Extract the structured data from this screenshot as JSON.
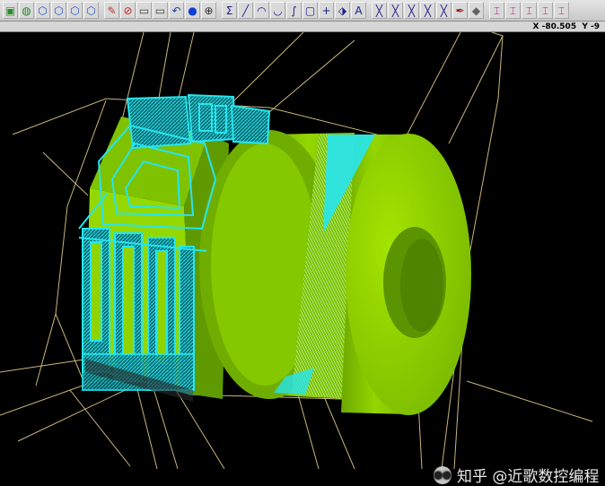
{
  "toolbar": {
    "buttons": [
      {
        "icon": "shaded-cube-icon",
        "glyph": "▣",
        "color": "#2a8a2a"
      },
      {
        "icon": "wire-cube-icon",
        "glyph": "◍",
        "color": "#2a8a2a"
      },
      {
        "icon": "view-cube-1-icon",
        "glyph": "⬡",
        "color": "#2456c8"
      },
      {
        "icon": "view-cube-2-icon",
        "glyph": "⬡",
        "color": "#2456c8"
      },
      {
        "icon": "view-cube-3-icon",
        "glyph": "⬡",
        "color": "#2456c8"
      },
      {
        "icon": "view-cube-4-icon",
        "glyph": "⬡",
        "color": "#2456c8"
      },
      {
        "icon": "pencil-icon",
        "glyph": "✎",
        "color": "#b03a3a"
      },
      {
        "icon": "no-entry-icon",
        "glyph": "⊘",
        "color": "#d02020"
      },
      {
        "icon": "monitor-icon",
        "glyph": "▭",
        "color": "#404040"
      },
      {
        "icon": "monitor-2-icon",
        "glyph": "▭",
        "color": "#404040"
      },
      {
        "icon": "undo-icon",
        "glyph": "↶",
        "color": "#2040a0"
      },
      {
        "icon": "sphere-icon",
        "glyph": "●",
        "color": "#1040d0"
      },
      {
        "icon": "zoom-icon",
        "glyph": "⊕",
        "color": "#303030"
      },
      {
        "icon": "sigma-icon",
        "glyph": "Σ",
        "color": "#1a1a8a"
      },
      {
        "icon": "line-icon",
        "glyph": "╱",
        "color": "#1a1a8a"
      },
      {
        "icon": "arc-icon",
        "glyph": "◠",
        "color": "#1a1a8a"
      },
      {
        "icon": "curve-icon",
        "glyph": "◡",
        "color": "#1a1a8a"
      },
      {
        "icon": "spline-icon",
        "glyph": "∫",
        "color": "#1a1a8a"
      },
      {
        "icon": "rectangle-icon",
        "glyph": "▢",
        "color": "#1a1a8a"
      },
      {
        "icon": "point-icon",
        "glyph": "+",
        "color": "#1a1a8a"
      },
      {
        "icon": "transform-icon",
        "glyph": "⬗",
        "color": "#1a1a8a"
      },
      {
        "icon": "text-box-icon",
        "glyph": "A",
        "color": "#1a1a8a"
      },
      {
        "icon": "trim-1-icon",
        "glyph": "╳",
        "color": "#1a1a8a"
      },
      {
        "icon": "trim-2-icon",
        "glyph": "╳",
        "color": "#1a1a8a"
      },
      {
        "icon": "trim-3-icon",
        "glyph": "╳",
        "color": "#1a1a8a"
      },
      {
        "icon": "trim-4-icon",
        "glyph": "╳",
        "color": "#1a1a8a"
      },
      {
        "icon": "trim-5-icon",
        "glyph": "╳",
        "color": "#1a1a8a"
      },
      {
        "icon": "pen-tool-icon",
        "glyph": "✒",
        "color": "#a02020"
      },
      {
        "icon": "fill-icon",
        "glyph": "◆",
        "color": "#606060"
      },
      {
        "icon": "toolpath-1-icon",
        "glyph": "⌶",
        "color": "#c02080"
      },
      {
        "icon": "toolpath-2-icon",
        "glyph": "⌶",
        "color": "#c02080"
      },
      {
        "icon": "toolpath-3-icon",
        "glyph": "⌶",
        "color": "#c02080"
      },
      {
        "icon": "toolpath-4-icon",
        "glyph": "⌶",
        "color": "#c02080"
      },
      {
        "icon": "toolpath-5-icon",
        "glyph": "⌶",
        "color": "#c02080"
      }
    ]
  },
  "status": {
    "coordinates": "X -80.505  Y -9"
  },
  "colors": {
    "background": "#000000",
    "part_green": "#8fd400",
    "part_green_dark": "#5f9a00",
    "fixture_cyan": "#26e5ef",
    "wire_yellow": "#c8b67a"
  },
  "watermark": {
    "text": "知乎 @近歌数控编程",
    "icon": "wechat-logo"
  }
}
